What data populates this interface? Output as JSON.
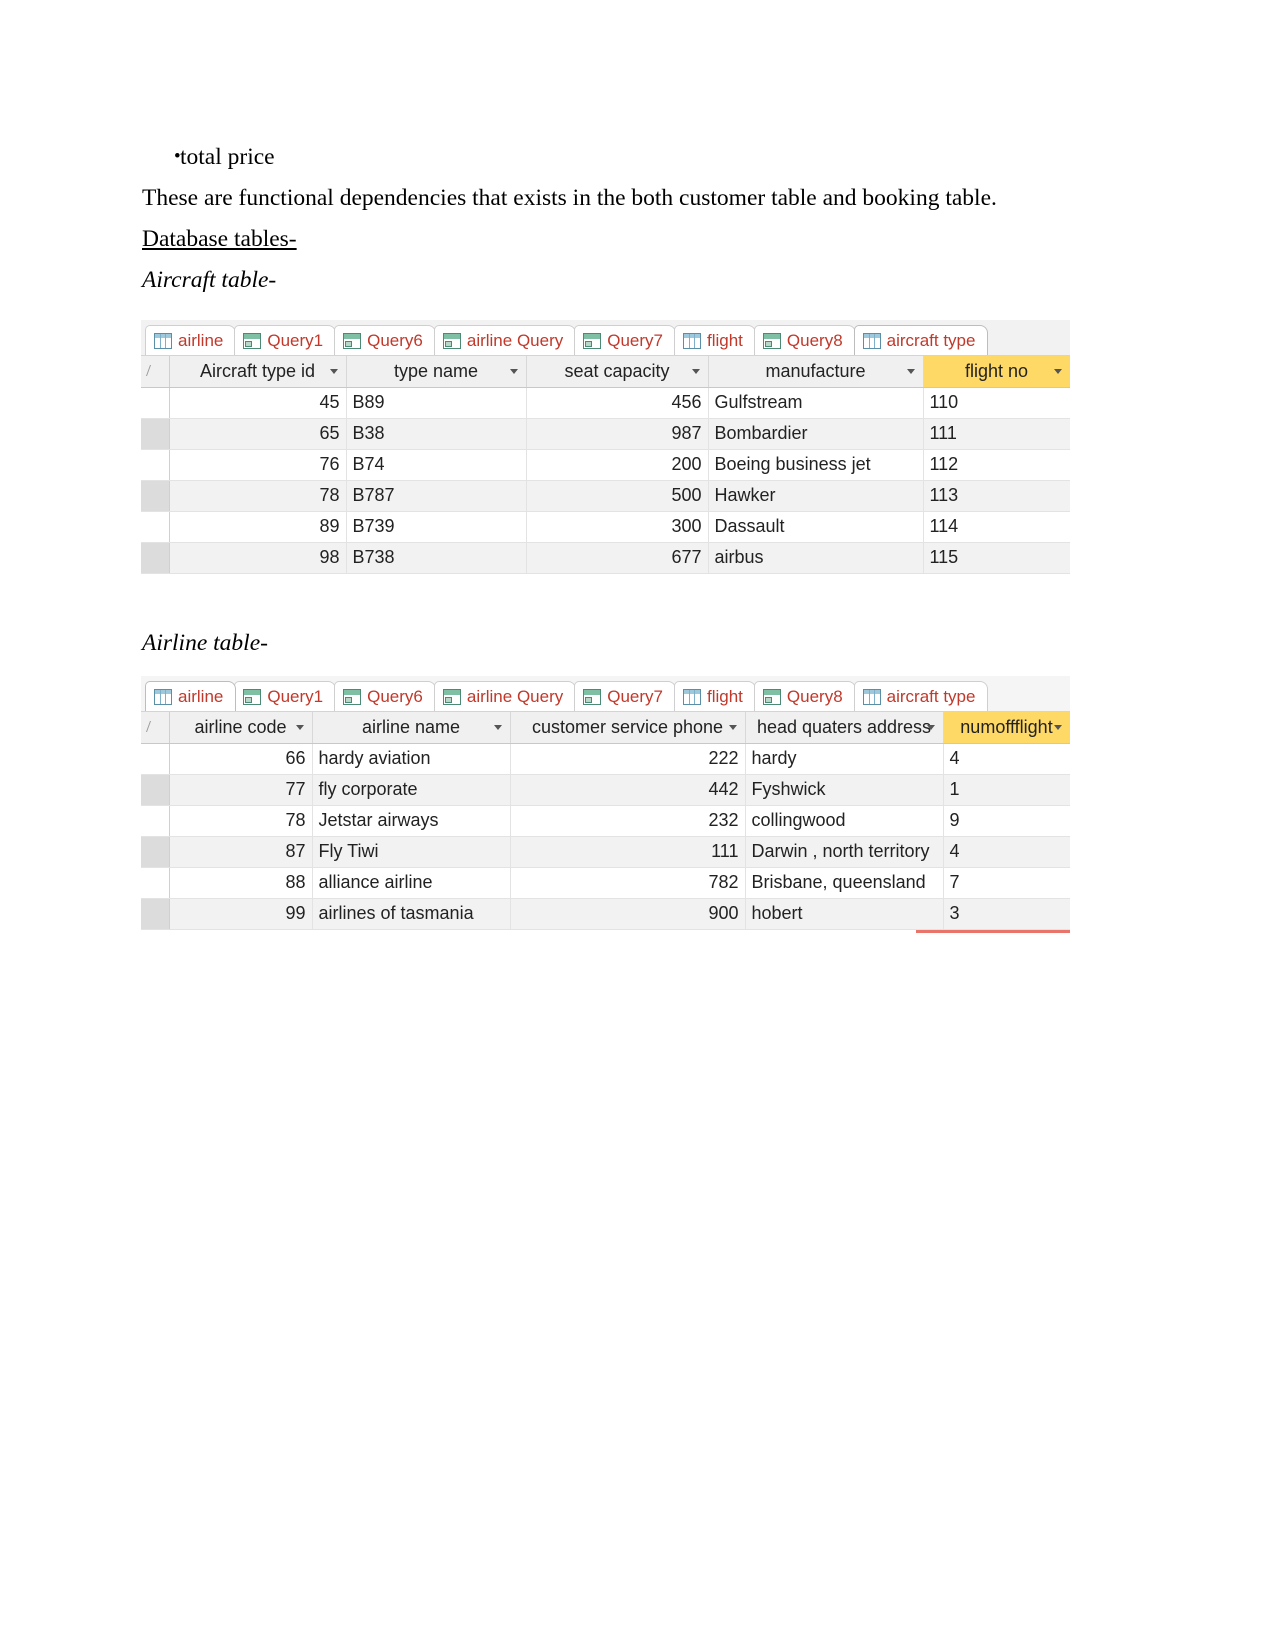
{
  "document": {
    "bullet": {
      "marker": "•",
      "text": "total price"
    },
    "paragraph": "These are functional dependencies that exists in the both customer table and booking table.",
    "section_heading": "Database tables-",
    "caption_aircraft": "Aircraft table-",
    "caption_airline": "Airline table-"
  },
  "colors": {
    "tab_text": "#c0392b",
    "highlight_header": "#ffd966",
    "redline": "#e8746a"
  },
  "aircraft_window": {
    "tabs": [
      {
        "label": "airline",
        "icon": "table-icon",
        "active": false
      },
      {
        "label": "Query1",
        "icon": "query-icon",
        "active": false
      },
      {
        "label": "Query6",
        "icon": "query-icon",
        "active": false
      },
      {
        "label": "airline Query",
        "icon": "query-icon",
        "active": false
      },
      {
        "label": "Query7",
        "icon": "query-icon",
        "active": false
      },
      {
        "label": "flight",
        "icon": "table-icon",
        "active": false
      },
      {
        "label": "Query8",
        "icon": "query-icon",
        "active": false
      },
      {
        "label": "aircraft type",
        "icon": "table-icon",
        "active": true
      }
    ],
    "columns": [
      {
        "label": "Aircraft type id",
        "align": "right",
        "highlight": false
      },
      {
        "label": "type name",
        "align": "left",
        "highlight": false
      },
      {
        "label": "seat capacity",
        "align": "right",
        "highlight": false
      },
      {
        "label": "manufacture",
        "align": "left",
        "highlight": false
      },
      {
        "label": "flight no",
        "align": "left",
        "highlight": true
      }
    ],
    "rows": [
      [
        "45",
        "B89",
        "456",
        "Gulfstream",
        "110"
      ],
      [
        "65",
        "B38",
        "987",
        "Bombardier",
        "111"
      ],
      [
        "76",
        "B74",
        "200",
        "Boeing business jet",
        "112"
      ],
      [
        "78",
        "B787",
        "500",
        "Hawker",
        "113"
      ],
      [
        "89",
        "B739",
        "300",
        "Dassault",
        "114"
      ],
      [
        "98",
        "B738",
        "677",
        "airbus",
        "115"
      ]
    ]
  },
  "airline_window": {
    "tabs": [
      {
        "label": "airline",
        "icon": "table-icon",
        "active": true
      },
      {
        "label": "Query1",
        "icon": "query-icon",
        "active": false
      },
      {
        "label": "Query6",
        "icon": "query-icon",
        "active": false
      },
      {
        "label": "airline Query",
        "icon": "query-icon",
        "active": false
      },
      {
        "label": "Query7",
        "icon": "query-icon",
        "active": false
      },
      {
        "label": "flight",
        "icon": "table-icon",
        "active": false
      },
      {
        "label": "Query8",
        "icon": "query-icon",
        "active": false
      },
      {
        "label": "aircraft type",
        "icon": "table-icon",
        "active": false
      }
    ],
    "columns": [
      {
        "label": "airline code",
        "align": "right",
        "highlight": false
      },
      {
        "label": "airline name",
        "align": "left",
        "highlight": false
      },
      {
        "label": "customer service phone",
        "align": "right",
        "highlight": false
      },
      {
        "label": "head quaters address",
        "align": "left",
        "highlight": false
      },
      {
        "label": "numoffflight",
        "align": "left",
        "highlight": true
      }
    ],
    "rows": [
      [
        "66",
        "hardy aviation",
        "222",
        "hardy",
        "4"
      ],
      [
        "77",
        "fly corporate",
        "442",
        "Fyshwick",
        "1"
      ],
      [
        "78",
        "Jetstar airways",
        "232",
        "collingwood",
        "9"
      ],
      [
        "87",
        "Fly Tiwi",
        "111",
        "Darwin , north territory",
        "4"
      ],
      [
        "88",
        "alliance airline",
        "782",
        "Brisbane, queensland",
        "7"
      ],
      [
        "99",
        "airlines of tasmania",
        "900",
        "hobert",
        "3"
      ]
    ]
  }
}
